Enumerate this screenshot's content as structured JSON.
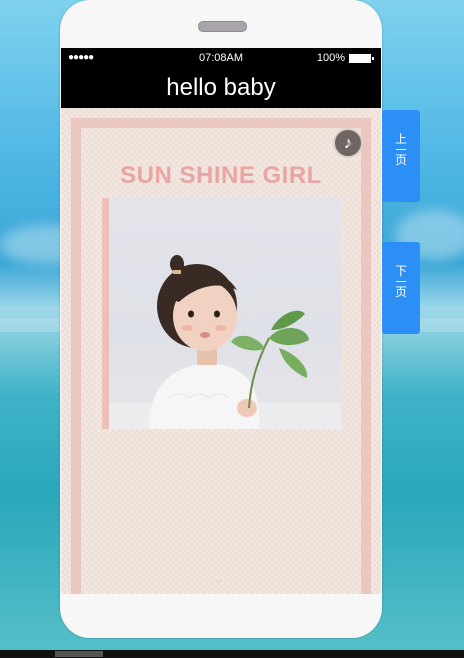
{
  "status": {
    "signal": "●●●●●",
    "time": "07:08AM",
    "battery": "100%"
  },
  "header": {
    "title": "hello baby"
  },
  "page": {
    "headline": "SUN SHINE GIRL",
    "music_icon": "music-note-icon"
  },
  "nav": {
    "prev_chars": [
      "上",
      "页"
    ],
    "next_chars": [
      "下",
      "页"
    ]
  },
  "colors": {
    "accent_blue": "#2b8ff5",
    "headline_pink": "#e8a6a3",
    "frame_pink": "#e9c6c0"
  }
}
